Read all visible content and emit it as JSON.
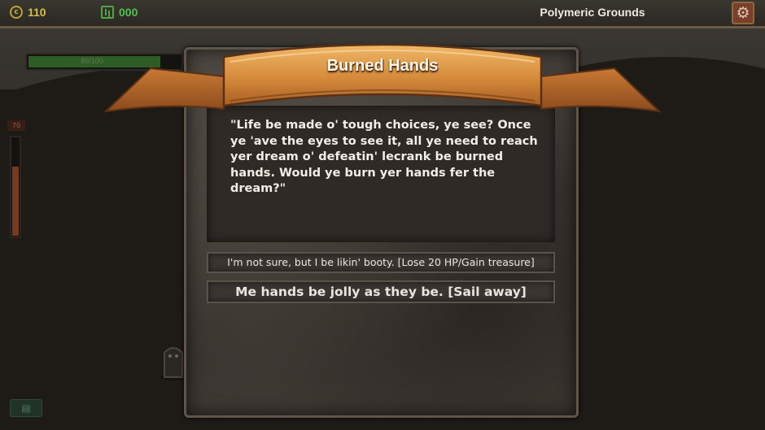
{
  "hud": {
    "gold": "110",
    "gems": "000",
    "location": "Polymeric Grounds",
    "hp_text": "89/100",
    "hp_fraction": 0.89,
    "heat_label": "70",
    "heat_fraction": 0.7
  },
  "dialog": {
    "title": "Burned Hands",
    "body": "\"Life be made o' tough choices, ye see? Once ye 'ave the eyes to see it, all ye need to reach yer dream o' defeatin' lecrank be burned hands. Would ye burn yer hands fer the dream?\"",
    "choices": [
      "I'm not sure, but I be likin' booty. [Lose 20 HP/Gain treasure]",
      "Me hands be jolly as they be. [Sail away]"
    ]
  },
  "icons": {
    "gold": "coin-icon",
    "gems": "chest-icon",
    "settings": "gear-icon",
    "bottom": "map-icon"
  },
  "colors": {
    "gold": "#d4bf4f",
    "gems": "#4fc14a",
    "banner": "#d9923f",
    "hp": "#2e5c25"
  }
}
